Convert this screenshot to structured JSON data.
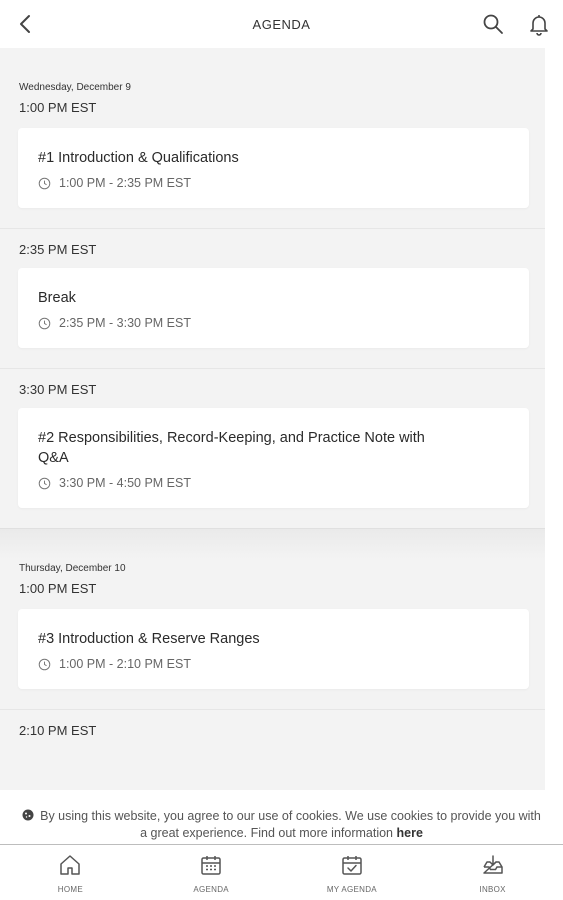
{
  "header": {
    "title": "AGENDA",
    "back_icon": "chevron-left-icon",
    "search_icon": "search-icon",
    "bell_icon": "bell-icon"
  },
  "days": [
    {
      "date": "Wednesday, December 9",
      "slots": [
        {
          "time": "1:00 PM EST",
          "session": {
            "title": "#1 Introduction & Qualifications",
            "range": "1:00 PM - 2:35 PM EST"
          }
        },
        {
          "time": "2:35 PM EST",
          "session": {
            "title": "Break",
            "range": "2:35 PM - 3:30 PM EST"
          }
        },
        {
          "time": "3:30 PM EST",
          "session": {
            "title": "#2 Responsibilities, Record-Keeping, and Practice Note with Q&A",
            "range": "3:30 PM - 4:50 PM EST"
          }
        }
      ]
    },
    {
      "date": "Thursday, December 10",
      "slots": [
        {
          "time": "1:00 PM EST",
          "session": {
            "title": "#3 Introduction & Reserve Ranges",
            "range": "1:00 PM - 2:10 PM EST"
          }
        },
        {
          "time": "2:10 PM EST"
        }
      ]
    }
  ],
  "cookie": {
    "text": "By using this website, you agree to our use of cookies. We use cookies to provide you with a great experience. Find out more information",
    "link": "here",
    "icon": "cookie-icon"
  },
  "nav": [
    {
      "label": "HOME",
      "icon": "home-icon"
    },
    {
      "label": "AGENDA",
      "icon": "calendar-icon"
    },
    {
      "label": "MY AGENDA",
      "icon": "calendar-check-icon"
    },
    {
      "label": "INBOX",
      "icon": "inbox-icon"
    }
  ],
  "colors": {
    "background": "#f3f3f3",
    "card": "#ffffff",
    "text": "#333333"
  }
}
